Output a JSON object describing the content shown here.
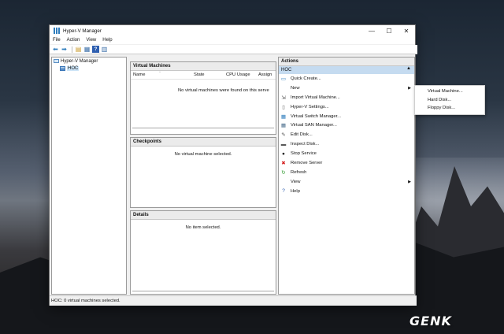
{
  "window": {
    "title": "Hyper-V Manager",
    "controls": {
      "minimize": "—",
      "maximize": "☐",
      "close": "✕"
    }
  },
  "menubar": {
    "items": [
      "File",
      "Action",
      "View",
      "Help"
    ]
  },
  "toolbar": {
    "buttons": [
      {
        "icon": "back-arrow-icon",
        "glyph": "⬅"
      },
      {
        "icon": "forward-arrow-icon",
        "glyph": "➡"
      },
      {
        "icon": "folder-up-icon",
        "glyph": "▤"
      },
      {
        "icon": "console-tree-icon",
        "glyph": "▦"
      },
      {
        "icon": "help-icon",
        "glyph": "?"
      },
      {
        "icon": "properties-icon",
        "glyph": "▥"
      }
    ]
  },
  "tree": {
    "root": "Hyper-V Manager",
    "host": "HOC"
  },
  "virtual_machines": {
    "header": "Virtual Machines",
    "columns": [
      "Name",
      "State",
      "CPU Usage",
      "Assign"
    ],
    "empty_message": "No virtual machines were found on this serve"
  },
  "checkpoints": {
    "header": "Checkpoints",
    "empty_message": "No virtual machine selected."
  },
  "details": {
    "header": "Details",
    "empty_message": "No item selected."
  },
  "actions": {
    "header": "Actions",
    "group": "HOC",
    "collapse_glyph": "▲",
    "submenu_glyph": "▶",
    "items": [
      {
        "label": "Quick Create...",
        "icon": "quick-create-icon",
        "glyph": "▭",
        "color": "#2f7dbd"
      },
      {
        "label": "New",
        "icon": "none",
        "glyph": "",
        "color": "#000000",
        "submenu": true
      },
      {
        "label": "Import Virtual Machine...",
        "icon": "import-icon",
        "glyph": "⇲",
        "color": "#444444"
      },
      {
        "label": "Hyper-V Settings...",
        "icon": "settings-icon",
        "glyph": "▯",
        "color": "#666666"
      },
      {
        "label": "Virtual Switch Manager...",
        "icon": "switch-icon",
        "glyph": "▦",
        "color": "#2f7dbd"
      },
      {
        "label": "Virtual SAN Manager...",
        "icon": "san-icon",
        "glyph": "▦",
        "color": "#4a6d8c"
      },
      {
        "label": "Edit Disk...",
        "icon": "edit-disk-icon",
        "glyph": "✎",
        "color": "#555555"
      },
      {
        "label": "Inspect Disk...",
        "icon": "inspect-disk-icon",
        "glyph": "▬",
        "color": "#555555"
      },
      {
        "label": "Stop Service",
        "icon": "stop-icon",
        "glyph": "●",
        "color": "#222222"
      },
      {
        "label": "Remove Server",
        "icon": "remove-icon",
        "glyph": "✖",
        "color": "#d42020"
      },
      {
        "label": "Refresh",
        "icon": "refresh-icon",
        "glyph": "↻",
        "color": "#2e9a2e"
      },
      {
        "label": "View",
        "icon": "none",
        "glyph": "",
        "color": "#000000",
        "submenu": true
      },
      {
        "label": "Help",
        "icon": "help-icon",
        "glyph": "?",
        "color": "#2f5fb0"
      }
    ]
  },
  "new_submenu": {
    "items": [
      "Virtual Machine...",
      "Hard Disk...",
      "Floppy Disk..."
    ]
  },
  "status": {
    "text": "HOC:  0 virtual machines selected."
  },
  "watermark": {
    "text": "GENK"
  }
}
